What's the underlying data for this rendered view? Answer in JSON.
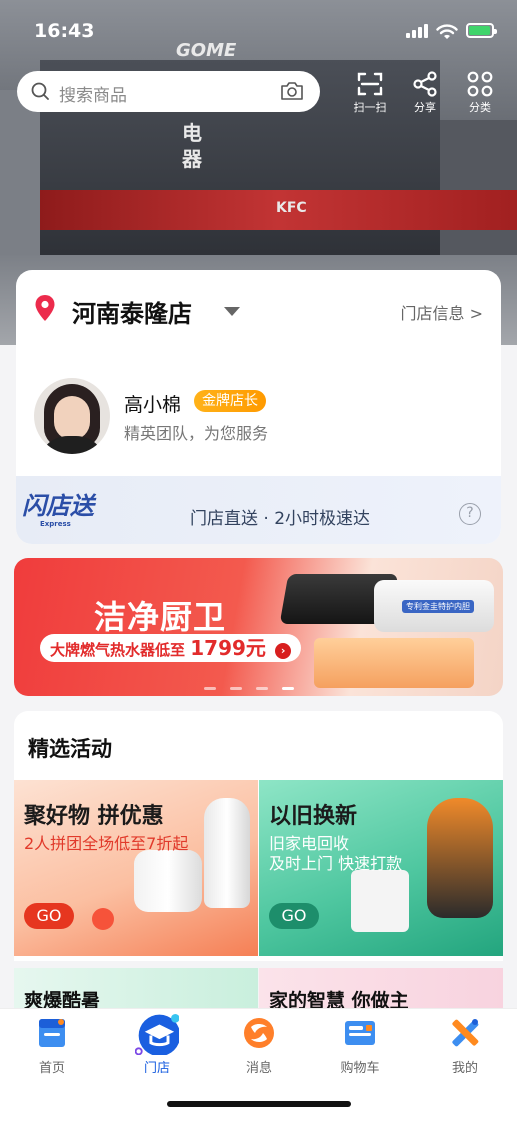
{
  "status_bar": {
    "time": "16:43"
  },
  "search": {
    "placeholder": "搜索商品"
  },
  "top_actions": [
    {
      "label": "扫一扫",
      "icon": "scan-icon"
    },
    {
      "label": "分享",
      "icon": "share-icon"
    },
    {
      "label": "分类",
      "icon": "category-icon"
    }
  ],
  "hero_signs": {
    "gome": "GOME",
    "dianqi": "电器",
    "kfc": "KFC"
  },
  "store": {
    "name": "河南泰隆店",
    "info_link": "门店信息 >",
    "manager_name": "高小棉",
    "manager_badge": "金牌店长",
    "manager_tagline": "精英团队，为您服务",
    "flash_logo": "闪店送",
    "flash_logo_sub": "Express",
    "flash_text": "门店直送 · 2小时极速达",
    "help": "?"
  },
  "banner": {
    "title": "洁净厨卫",
    "promo_prefix": "大牌燃气热水器低至",
    "promo_price": "1799元",
    "heater_label": "专利金圭特护内胆"
  },
  "featured": {
    "heading": "精选活动",
    "tiles": [
      {
        "title": "聚好物 拼优惠",
        "subtitle": "2人拼团全场低至7折起",
        "cta": "GO"
      },
      {
        "title": "以旧换新",
        "subtitle_line1": "旧家电回收",
        "subtitle_line2": "及时上门 快速打款",
        "cta": "GO"
      }
    ],
    "next_tiles": [
      "爽爆酷暑",
      "家的智慧 你做主"
    ]
  },
  "tabbar": {
    "items": [
      {
        "label": "首页",
        "icon": "home-icon"
      },
      {
        "label": "门店",
        "icon": "store-icon",
        "active": true
      },
      {
        "label": "消息",
        "icon": "message-icon"
      },
      {
        "label": "购物车",
        "icon": "cart-icon"
      },
      {
        "label": "我的",
        "icon": "profile-icon"
      }
    ]
  },
  "colors": {
    "accent": "#1a5fe0",
    "promo_red": "#e22b2b",
    "badge_gold": "#ffa40c"
  }
}
